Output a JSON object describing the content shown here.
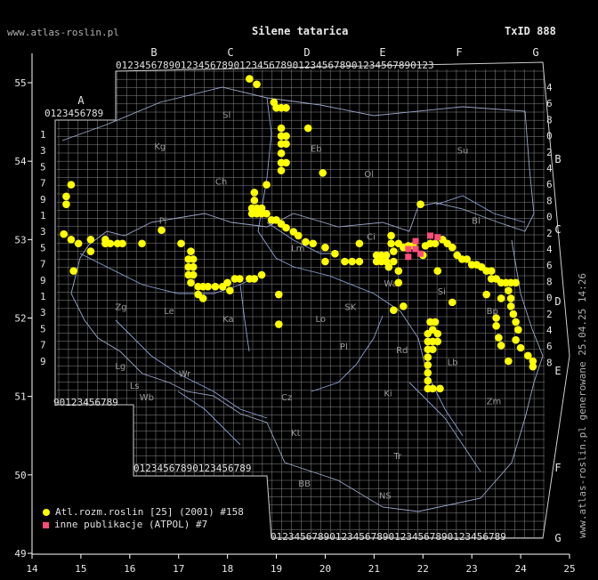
{
  "header": {
    "site": "www.atlas-roslin.pl",
    "title": "Silene tatarica",
    "taxon_id": "TxID 888"
  },
  "side_text": "www.atlas-roslin.pl generowane 25.04.25 14:26",
  "legend": [
    {
      "label": "Atl.rozm.roslin [25] (2001) #158",
      "color": "#ffff00",
      "shape": "circle"
    },
    {
      "label": "inne publikacje (ATPOL) #7",
      "color": "#ff4d7a",
      "shape": "square"
    }
  ],
  "axes": {
    "x_ticks": [
      "14",
      "15",
      "16",
      "17",
      "18",
      "19",
      "20",
      "21",
      "22",
      "23",
      "24",
      "25"
    ],
    "y_ticks": [
      "49",
      "50",
      "51",
      "52",
      "53",
      "54",
      "55"
    ]
  },
  "atpol_letters": {
    "top": [
      "A",
      "B",
      "C",
      "D",
      "E",
      "F",
      "G"
    ],
    "right": [
      "B",
      "C",
      "D",
      "E",
      "F",
      "G"
    ]
  },
  "digit_strip": "0123456789",
  "right_strip": [
    "4",
    "6",
    "8",
    "0",
    "2",
    "4",
    "6",
    "8",
    "0",
    "2",
    "4",
    "6",
    "8",
    "0",
    "2",
    "4",
    "6",
    "8"
  ],
  "left_strip": [
    "1",
    "3",
    "5",
    "7",
    "9",
    "1",
    "3",
    "5",
    "7",
    "9",
    "1",
    "3",
    "5",
    "7",
    "9"
  ],
  "region_labels": [
    {
      "t": "Sl",
      "lon": 17.9,
      "lat": 54.55
    },
    {
      "t": "Kg",
      "lon": 16.5,
      "lat": 54.15
    },
    {
      "t": "Eb",
      "lon": 19.7,
      "lat": 54.12
    },
    {
      "t": "Su",
      "lon": 22.7,
      "lat": 54.1
    },
    {
      "t": "Ol",
      "lon": 20.8,
      "lat": 53.8
    },
    {
      "t": "Ch",
      "lon": 17.75,
      "lat": 53.7
    },
    {
      "t": "Bi",
      "lon": 23.0,
      "lat": 53.2
    },
    {
      "t": "Pi",
      "lon": 16.6,
      "lat": 53.2
    },
    {
      "t": "Ci",
      "lon": 20.85,
      "lat": 53.0
    },
    {
      "t": "Lm",
      "lon": 19.3,
      "lat": 52.85
    },
    {
      "t": "Wa",
      "lon": 21.2,
      "lat": 52.4
    },
    {
      "t": "Si",
      "lon": 22.3,
      "lat": 52.3
    },
    {
      "t": "Zg",
      "lon": 15.7,
      "lat": 52.1
    },
    {
      "t": "Le",
      "lon": 16.7,
      "lat": 52.05
    },
    {
      "t": "SK",
      "lon": 20.4,
      "lat": 52.1
    },
    {
      "t": "Bp",
      "lon": 23.3,
      "lat": 52.05
    },
    {
      "t": "Ka",
      "lon": 17.9,
      "lat": 51.95
    },
    {
      "t": "Lo",
      "lon": 19.8,
      "lat": 51.95
    },
    {
      "t": "Pl",
      "lon": 20.3,
      "lat": 51.6
    },
    {
      "t": "Rd",
      "lon": 21.45,
      "lat": 51.55
    },
    {
      "t": "Lb",
      "lon": 22.5,
      "lat": 51.4
    },
    {
      "t": "Lg",
      "lon": 15.7,
      "lat": 51.35
    },
    {
      "t": "Wr",
      "lon": 17.0,
      "lat": 51.25
    },
    {
      "t": "Ls",
      "lon": 16.0,
      "lat": 51.1
    },
    {
      "t": "Wb",
      "lon": 16.2,
      "lat": 50.95
    },
    {
      "t": "Cz",
      "lon": 19.1,
      "lat": 50.95
    },
    {
      "t": "Ki",
      "lon": 21.2,
      "lat": 51.0
    },
    {
      "t": "Zm",
      "lon": 23.3,
      "lat": 50.9
    },
    {
      "t": "Kt",
      "lon": 19.3,
      "lat": 50.5
    },
    {
      "t": "Tr",
      "lon": 21.4,
      "lat": 50.2
    },
    {
      "t": "BB",
      "lon": 19.45,
      "lat": 49.85
    },
    {
      "t": "NS",
      "lon": 21.1,
      "lat": 49.7
    }
  ],
  "chart_data": {
    "type": "scatter",
    "xlabel": "",
    "ylabel": "",
    "xlim": [
      14,
      25
    ],
    "ylim": [
      49,
      55.4
    ],
    "series": [
      {
        "name": "Atl.rozm.roslin [25] (2001) #158",
        "points": [
          [
            18.45,
            55.05
          ],
          [
            18.6,
            54.98
          ],
          [
            18.95,
            54.75
          ],
          [
            19.0,
            54.68
          ],
          [
            19.1,
            54.68
          ],
          [
            19.2,
            54.68
          ],
          [
            19.65,
            54.42
          ],
          [
            19.1,
            54.42
          ],
          [
            19.1,
            54.32
          ],
          [
            19.2,
            54.32
          ],
          [
            19.1,
            54.22
          ],
          [
            19.2,
            54.22
          ],
          [
            19.1,
            54.1
          ],
          [
            19.1,
            53.98
          ],
          [
            19.2,
            53.98
          ],
          [
            19.1,
            53.88
          ],
          [
            19.95,
            53.85
          ],
          [
            18.8,
            53.7
          ],
          [
            18.55,
            53.6
          ],
          [
            18.55,
            53.5
          ],
          [
            18.5,
            53.4
          ],
          [
            18.6,
            53.4
          ],
          [
            18.7,
            53.4
          ],
          [
            18.5,
            53.33
          ],
          [
            18.6,
            53.33
          ],
          [
            18.7,
            53.33
          ],
          [
            18.8,
            53.33
          ],
          [
            18.9,
            53.25
          ],
          [
            19.0,
            53.25
          ],
          [
            19.1,
            53.2
          ],
          [
            19.2,
            53.15
          ],
          [
            19.35,
            53.1
          ],
          [
            19.45,
            53.05
          ],
          [
            19.6,
            52.97
          ],
          [
            19.75,
            52.95
          ],
          [
            20.0,
            52.9
          ],
          [
            20.2,
            52.82
          ],
          [
            20.4,
            52.72
          ],
          [
            20.55,
            52.72
          ],
          [
            20.7,
            52.72
          ],
          [
            21.05,
            52.72
          ],
          [
            21.05,
            52.8
          ],
          [
            21.15,
            52.72
          ],
          [
            21.25,
            52.72
          ],
          [
            21.15,
            52.8
          ],
          [
            21.25,
            52.8
          ],
          [
            21.3,
            52.65
          ],
          [
            21.4,
            52.72
          ],
          [
            21.4,
            52.85
          ],
          [
            21.35,
            52.95
          ],
          [
            21.35,
            53.05
          ],
          [
            21.5,
            52.95
          ],
          [
            21.6,
            52.9
          ],
          [
            21.7,
            52.92
          ],
          [
            21.8,
            52.92
          ],
          [
            22.05,
            52.92
          ],
          [
            22.15,
            52.95
          ],
          [
            22.25,
            52.95
          ],
          [
            22.4,
            53.0
          ],
          [
            22.5,
            52.95
          ],
          [
            22.6,
            52.9
          ],
          [
            22.7,
            52.8
          ],
          [
            22.8,
            52.75
          ],
          [
            22.9,
            52.75
          ],
          [
            23.0,
            52.68
          ],
          [
            23.1,
            52.68
          ],
          [
            23.2,
            52.65
          ],
          [
            23.3,
            52.6
          ],
          [
            23.4,
            52.6
          ],
          [
            23.4,
            52.5
          ],
          [
            23.5,
            52.5
          ],
          [
            23.6,
            52.45
          ],
          [
            23.7,
            52.45
          ],
          [
            23.8,
            52.45
          ],
          [
            23.9,
            52.45
          ],
          [
            23.75,
            52.35
          ],
          [
            23.8,
            52.25
          ],
          [
            23.8,
            52.15
          ],
          [
            23.85,
            52.05
          ],
          [
            23.9,
            51.95
          ],
          [
            23.95,
            51.85
          ],
          [
            23.9,
            51.72
          ],
          [
            24.0,
            51.62
          ],
          [
            24.15,
            51.52
          ],
          [
            24.25,
            51.45
          ],
          [
            24.25,
            51.38
          ],
          [
            23.75,
            51.45
          ],
          [
            23.6,
            51.65
          ],
          [
            23.55,
            51.75
          ],
          [
            23.5,
            51.9
          ],
          [
            23.5,
            52.0
          ],
          [
            23.6,
            52.25
          ],
          [
            23.3,
            52.3
          ],
          [
            22.6,
            52.2
          ],
          [
            22.3,
            52.6
          ],
          [
            22.0,
            52.8
          ],
          [
            21.5,
            52.6
          ],
          [
            21.5,
            52.45
          ],
          [
            21.6,
            52.15
          ],
          [
            21.4,
            52.1
          ],
          [
            20.7,
            52.95
          ],
          [
            20.0,
            52.72
          ],
          [
            21.95,
            53.45
          ],
          [
            22.15,
            51.95
          ],
          [
            22.25,
            51.95
          ],
          [
            22.2,
            51.85
          ],
          [
            22.1,
            51.8
          ],
          [
            22.3,
            51.8
          ],
          [
            22.1,
            51.7
          ],
          [
            22.2,
            51.7
          ],
          [
            22.3,
            51.7
          ],
          [
            22.1,
            51.6
          ],
          [
            22.2,
            51.6
          ],
          [
            22.1,
            51.5
          ],
          [
            22.1,
            51.4
          ],
          [
            22.1,
            51.3
          ],
          [
            22.1,
            51.2
          ],
          [
            22.1,
            51.1
          ],
          [
            22.2,
            51.1
          ],
          [
            22.35,
            51.1
          ],
          [
            18.7,
            52.55
          ],
          [
            18.55,
            52.5
          ],
          [
            18.45,
            52.5
          ],
          [
            18.25,
            52.5
          ],
          [
            18.15,
            52.5
          ],
          [
            18.0,
            52.45
          ],
          [
            17.9,
            52.4
          ],
          [
            17.75,
            52.4
          ],
          [
            17.6,
            52.4
          ],
          [
            17.5,
            52.4
          ],
          [
            17.4,
            52.4
          ],
          [
            17.25,
            52.45
          ],
          [
            17.2,
            52.55
          ],
          [
            17.3,
            52.55
          ],
          [
            17.2,
            52.65
          ],
          [
            17.3,
            52.65
          ],
          [
            17.2,
            52.75
          ],
          [
            17.3,
            52.75
          ],
          [
            17.25,
            52.85
          ],
          [
            17.05,
            52.95
          ],
          [
            17.4,
            52.3
          ],
          [
            17.5,
            52.25
          ],
          [
            18.05,
            52.35
          ],
          [
            16.65,
            53.12
          ],
          [
            16.25,
            52.95
          ],
          [
            15.85,
            52.95
          ],
          [
            15.75,
            52.95
          ],
          [
            15.6,
            52.95
          ],
          [
            15.5,
            52.95
          ],
          [
            15.5,
            53.0
          ],
          [
            15.2,
            52.85
          ],
          [
            15.2,
            53.0
          ],
          [
            14.95,
            52.95
          ],
          [
            14.8,
            53.0
          ],
          [
            14.65,
            53.07
          ],
          [
            14.85,
            52.6
          ],
          [
            14.7,
            53.45
          ],
          [
            14.7,
            53.55
          ],
          [
            14.8,
            53.7
          ],
          [
            19.05,
            52.3
          ],
          [
            19.05,
            51.92
          ]
        ]
      },
      {
        "name": "inne publikacje (ATPOL) #7",
        "points": [
          [
            22.15,
            53.05
          ],
          [
            22.3,
            53.03
          ],
          [
            21.85,
            52.98
          ],
          [
            21.7,
            52.88
          ],
          [
            21.85,
            52.88
          ],
          [
            21.95,
            52.82
          ],
          [
            21.7,
            52.78
          ]
        ]
      }
    ]
  }
}
